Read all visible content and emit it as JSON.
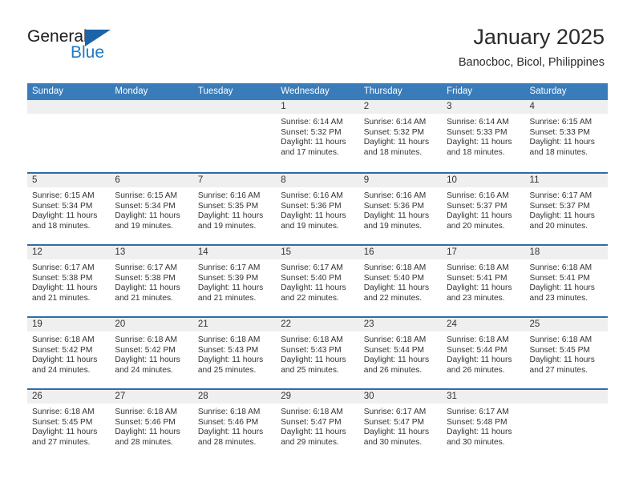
{
  "logo": {
    "word_one": "General",
    "word_two": "Blue",
    "accent_dark": "#1a64ab",
    "accent_light": "#1f7ac4"
  },
  "header": {
    "title": "January 2025",
    "subtitle": "Banocboc, Bicol, Philippines"
  },
  "theme": {
    "header_blue": "#3a7cba",
    "row_divider_blue": "#2e6da8",
    "daynum_band_gray": "#efefef"
  },
  "weekdays": [
    "Sunday",
    "Monday",
    "Tuesday",
    "Wednesday",
    "Thursday",
    "Friday",
    "Saturday"
  ],
  "weeks": [
    [
      {
        "day": "",
        "sunrise": "",
        "sunset": "",
        "daylight_line1": "",
        "daylight_line2": "",
        "empty": true
      },
      {
        "day": "",
        "sunrise": "",
        "sunset": "",
        "daylight_line1": "",
        "daylight_line2": "",
        "empty": true
      },
      {
        "day": "",
        "sunrise": "",
        "sunset": "",
        "daylight_line1": "",
        "daylight_line2": "",
        "empty": true
      },
      {
        "day": "1",
        "sunrise": "Sunrise: 6:14 AM",
        "sunset": "Sunset: 5:32 PM",
        "daylight_line1": "Daylight: 11 hours",
        "daylight_line2": "and 17 minutes.",
        "empty": false
      },
      {
        "day": "2",
        "sunrise": "Sunrise: 6:14 AM",
        "sunset": "Sunset: 5:32 PM",
        "daylight_line1": "Daylight: 11 hours",
        "daylight_line2": "and 18 minutes.",
        "empty": false
      },
      {
        "day": "3",
        "sunrise": "Sunrise: 6:14 AM",
        "sunset": "Sunset: 5:33 PM",
        "daylight_line1": "Daylight: 11 hours",
        "daylight_line2": "and 18 minutes.",
        "empty": false
      },
      {
        "day": "4",
        "sunrise": "Sunrise: 6:15 AM",
        "sunset": "Sunset: 5:33 PM",
        "daylight_line1": "Daylight: 11 hours",
        "daylight_line2": "and 18 minutes.",
        "empty": false
      }
    ],
    [
      {
        "day": "5",
        "sunrise": "Sunrise: 6:15 AM",
        "sunset": "Sunset: 5:34 PM",
        "daylight_line1": "Daylight: 11 hours",
        "daylight_line2": "and 18 minutes.",
        "empty": false
      },
      {
        "day": "6",
        "sunrise": "Sunrise: 6:15 AM",
        "sunset": "Sunset: 5:34 PM",
        "daylight_line1": "Daylight: 11 hours",
        "daylight_line2": "and 19 minutes.",
        "empty": false
      },
      {
        "day": "7",
        "sunrise": "Sunrise: 6:16 AM",
        "sunset": "Sunset: 5:35 PM",
        "daylight_line1": "Daylight: 11 hours",
        "daylight_line2": "and 19 minutes.",
        "empty": false
      },
      {
        "day": "8",
        "sunrise": "Sunrise: 6:16 AM",
        "sunset": "Sunset: 5:36 PM",
        "daylight_line1": "Daylight: 11 hours",
        "daylight_line2": "and 19 minutes.",
        "empty": false
      },
      {
        "day": "9",
        "sunrise": "Sunrise: 6:16 AM",
        "sunset": "Sunset: 5:36 PM",
        "daylight_line1": "Daylight: 11 hours",
        "daylight_line2": "and 19 minutes.",
        "empty": false
      },
      {
        "day": "10",
        "sunrise": "Sunrise: 6:16 AM",
        "sunset": "Sunset: 5:37 PM",
        "daylight_line1": "Daylight: 11 hours",
        "daylight_line2": "and 20 minutes.",
        "empty": false
      },
      {
        "day": "11",
        "sunrise": "Sunrise: 6:17 AM",
        "sunset": "Sunset: 5:37 PM",
        "daylight_line1": "Daylight: 11 hours",
        "daylight_line2": "and 20 minutes.",
        "empty": false
      }
    ],
    [
      {
        "day": "12",
        "sunrise": "Sunrise: 6:17 AM",
        "sunset": "Sunset: 5:38 PM",
        "daylight_line1": "Daylight: 11 hours",
        "daylight_line2": "and 21 minutes.",
        "empty": false
      },
      {
        "day": "13",
        "sunrise": "Sunrise: 6:17 AM",
        "sunset": "Sunset: 5:38 PM",
        "daylight_line1": "Daylight: 11 hours",
        "daylight_line2": "and 21 minutes.",
        "empty": false
      },
      {
        "day": "14",
        "sunrise": "Sunrise: 6:17 AM",
        "sunset": "Sunset: 5:39 PM",
        "daylight_line1": "Daylight: 11 hours",
        "daylight_line2": "and 21 minutes.",
        "empty": false
      },
      {
        "day": "15",
        "sunrise": "Sunrise: 6:17 AM",
        "sunset": "Sunset: 5:40 PM",
        "daylight_line1": "Daylight: 11 hours",
        "daylight_line2": "and 22 minutes.",
        "empty": false
      },
      {
        "day": "16",
        "sunrise": "Sunrise: 6:18 AM",
        "sunset": "Sunset: 5:40 PM",
        "daylight_line1": "Daylight: 11 hours",
        "daylight_line2": "and 22 minutes.",
        "empty": false
      },
      {
        "day": "17",
        "sunrise": "Sunrise: 6:18 AM",
        "sunset": "Sunset: 5:41 PM",
        "daylight_line1": "Daylight: 11 hours",
        "daylight_line2": "and 23 minutes.",
        "empty": false
      },
      {
        "day": "18",
        "sunrise": "Sunrise: 6:18 AM",
        "sunset": "Sunset: 5:41 PM",
        "daylight_line1": "Daylight: 11 hours",
        "daylight_line2": "and 23 minutes.",
        "empty": false
      }
    ],
    [
      {
        "day": "19",
        "sunrise": "Sunrise: 6:18 AM",
        "sunset": "Sunset: 5:42 PM",
        "daylight_line1": "Daylight: 11 hours",
        "daylight_line2": "and 24 minutes.",
        "empty": false
      },
      {
        "day": "20",
        "sunrise": "Sunrise: 6:18 AM",
        "sunset": "Sunset: 5:42 PM",
        "daylight_line1": "Daylight: 11 hours",
        "daylight_line2": "and 24 minutes.",
        "empty": false
      },
      {
        "day": "21",
        "sunrise": "Sunrise: 6:18 AM",
        "sunset": "Sunset: 5:43 PM",
        "daylight_line1": "Daylight: 11 hours",
        "daylight_line2": "and 25 minutes.",
        "empty": false
      },
      {
        "day": "22",
        "sunrise": "Sunrise: 6:18 AM",
        "sunset": "Sunset: 5:43 PM",
        "daylight_line1": "Daylight: 11 hours",
        "daylight_line2": "and 25 minutes.",
        "empty": false
      },
      {
        "day": "23",
        "sunrise": "Sunrise: 6:18 AM",
        "sunset": "Sunset: 5:44 PM",
        "daylight_line1": "Daylight: 11 hours",
        "daylight_line2": "and 26 minutes.",
        "empty": false
      },
      {
        "day": "24",
        "sunrise": "Sunrise: 6:18 AM",
        "sunset": "Sunset: 5:44 PM",
        "daylight_line1": "Daylight: 11 hours",
        "daylight_line2": "and 26 minutes.",
        "empty": false
      },
      {
        "day": "25",
        "sunrise": "Sunrise: 6:18 AM",
        "sunset": "Sunset: 5:45 PM",
        "daylight_line1": "Daylight: 11 hours",
        "daylight_line2": "and 27 minutes.",
        "empty": false
      }
    ],
    [
      {
        "day": "26",
        "sunrise": "Sunrise: 6:18 AM",
        "sunset": "Sunset: 5:45 PM",
        "daylight_line1": "Daylight: 11 hours",
        "daylight_line2": "and 27 minutes.",
        "empty": false
      },
      {
        "day": "27",
        "sunrise": "Sunrise: 6:18 AM",
        "sunset": "Sunset: 5:46 PM",
        "daylight_line1": "Daylight: 11 hours",
        "daylight_line2": "and 28 minutes.",
        "empty": false
      },
      {
        "day": "28",
        "sunrise": "Sunrise: 6:18 AM",
        "sunset": "Sunset: 5:46 PM",
        "daylight_line1": "Daylight: 11 hours",
        "daylight_line2": "and 28 minutes.",
        "empty": false
      },
      {
        "day": "29",
        "sunrise": "Sunrise: 6:18 AM",
        "sunset": "Sunset: 5:47 PM",
        "daylight_line1": "Daylight: 11 hours",
        "daylight_line2": "and 29 minutes.",
        "empty": false
      },
      {
        "day": "30",
        "sunrise": "Sunrise: 6:17 AM",
        "sunset": "Sunset: 5:47 PM",
        "daylight_line1": "Daylight: 11 hours",
        "daylight_line2": "and 30 minutes.",
        "empty": false
      },
      {
        "day": "31",
        "sunrise": "Sunrise: 6:17 AM",
        "sunset": "Sunset: 5:48 PM",
        "daylight_line1": "Daylight: 11 hours",
        "daylight_line2": "and 30 minutes.",
        "empty": false
      },
      {
        "day": "",
        "sunrise": "",
        "sunset": "",
        "daylight_line1": "",
        "daylight_line2": "",
        "empty": true
      }
    ]
  ]
}
